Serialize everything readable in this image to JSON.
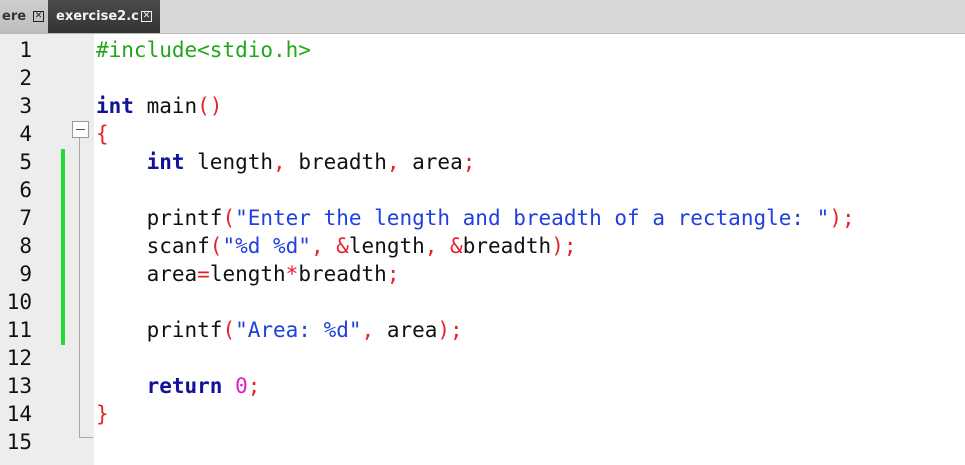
{
  "tabs": [
    {
      "label": "ere",
      "close": "✕",
      "active": false
    },
    {
      "label": "exercise2.c",
      "close": "✕",
      "active": true
    }
  ],
  "line_numbers": [
    "1",
    "2",
    "3",
    "4",
    "5",
    "6",
    "7",
    "8",
    "9",
    "10",
    "11",
    "12",
    "13",
    "14",
    "15"
  ],
  "changed_lines": [
    "5",
    "6",
    "7",
    "8",
    "9",
    "10",
    "11"
  ],
  "colors": {
    "preprocessor": "#22a61a",
    "keyword": "#111199",
    "identifier": "#111111",
    "operator": "#e8202a",
    "string": "#1f3fe0",
    "number": "#e01cc8",
    "change_marker": "#22dd33",
    "gutter": "#ededed"
  },
  "code_lines": [
    [
      {
        "t": "#include<stdio.h>",
        "c": "pre"
      }
    ],
    [],
    [
      {
        "t": "int",
        "c": "kw"
      },
      {
        "t": " main",
        "c": "id"
      },
      {
        "t": "()",
        "c": "op"
      }
    ],
    [
      {
        "t": "{",
        "c": "op"
      }
    ],
    [
      {
        "t": "    ",
        "c": "id"
      },
      {
        "t": "int",
        "c": "kw"
      },
      {
        "t": " length",
        "c": "id"
      },
      {
        "t": ",",
        "c": "op"
      },
      {
        "t": " breadth",
        "c": "id"
      },
      {
        "t": ",",
        "c": "op"
      },
      {
        "t": " area",
        "c": "id"
      },
      {
        "t": ";",
        "c": "op"
      }
    ],
    [],
    [
      {
        "t": "    printf",
        "c": "id"
      },
      {
        "t": "(",
        "c": "op"
      },
      {
        "t": "\"Enter the length and breadth of a rectangle: \"",
        "c": "str"
      },
      {
        "t": ");",
        "c": "op"
      }
    ],
    [
      {
        "t": "    scanf",
        "c": "id"
      },
      {
        "t": "(",
        "c": "op"
      },
      {
        "t": "\"%d %d\"",
        "c": "str"
      },
      {
        "t": ", &",
        "c": "op"
      },
      {
        "t": "length",
        "c": "id"
      },
      {
        "t": ", &",
        "c": "op"
      },
      {
        "t": "breadth",
        "c": "id"
      },
      {
        "t": ");",
        "c": "op"
      }
    ],
    [
      {
        "t": "    area",
        "c": "id"
      },
      {
        "t": "=",
        "c": "op"
      },
      {
        "t": "length",
        "c": "id"
      },
      {
        "t": "*",
        "c": "op"
      },
      {
        "t": "breadth",
        "c": "id"
      },
      {
        "t": ";",
        "c": "op"
      }
    ],
    [],
    [
      {
        "t": "    printf",
        "c": "id"
      },
      {
        "t": "(",
        "c": "op"
      },
      {
        "t": "\"Area: %d\"",
        "c": "str"
      },
      {
        "t": ",",
        "c": "op"
      },
      {
        "t": " area",
        "c": "id"
      },
      {
        "t": ");",
        "c": "op"
      }
    ],
    [],
    [
      {
        "t": "    ",
        "c": "id"
      },
      {
        "t": "return",
        "c": "kw"
      },
      {
        "t": " ",
        "c": "id"
      },
      {
        "t": "0",
        "c": "num"
      },
      {
        "t": ";",
        "c": "op"
      }
    ],
    [
      {
        "t": "}",
        "c": "op"
      }
    ],
    []
  ]
}
